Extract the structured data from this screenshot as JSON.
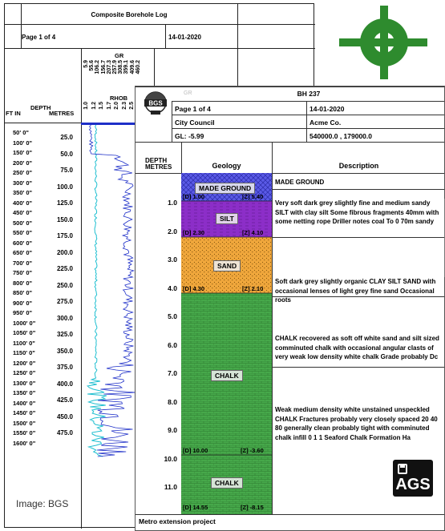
{
  "composite": {
    "title": "Composite Borehole Log",
    "page": "Page 1 of 4",
    "date": "14-01-2020",
    "gr_label": "GR",
    "rhob_label": "RHOB",
    "gr_scale": [
      "5.9",
      "55.6",
      "106.2",
      "156.7",
      "207.3",
      "257.9",
      "308.5",
      "359.1",
      "409.6",
      "460.2"
    ],
    "rhob_scale": [
      "1.0",
      "1.2",
      "1.5",
      "1.7",
      "2.0",
      "2.3",
      "2.5"
    ],
    "depth_header": "DEPTH",
    "ft_header": "FT IN",
    "metres_header": "METRES",
    "ft_ticks": [
      "50' 0\"",
      "100' 0\"",
      "150' 0\"",
      "200' 0\"",
      "250' 0\"",
      "300' 0\"",
      "350' 0\"",
      "400' 0\"",
      "450' 0\"",
      "500' 0\"",
      "550' 0\"",
      "600' 0\"",
      "650' 0\"",
      "700' 0\"",
      "750' 0\"",
      "800' 0\"",
      "850' 0\"",
      "900' 0\"",
      "950' 0\"",
      "1000' 0\"",
      "1050' 0\"",
      "1100' 0\"",
      "1150' 0\"",
      "1200' 0\"",
      "1250' 0\"",
      "1300' 0\"",
      "1350' 0\"",
      "1400' 0\"",
      "1450' 0\"",
      "1500' 0\"",
      "1550' 0\"",
      "1600' 0\""
    ],
    "metre_ticks": [
      "25.0",
      "50.0",
      "75.0",
      "100.0",
      "125.0",
      "150.0",
      "175.0",
      "200.0",
      "225.0",
      "250.0",
      "275.0",
      "300.0",
      "325.0",
      "350.0",
      "375.0",
      "400.0",
      "425.0",
      "450.0",
      "475.0"
    ]
  },
  "bgs_log": {
    "borehole": "BH 237",
    "page": "Page 1 of 4",
    "date": "14-01-2020",
    "client": "City Council",
    "contractor": "Acme Co.",
    "ground_level": "GL: -5.99",
    "coordinates": "540000.0 , 179000.0",
    "depth_header": "DEPTH",
    "metres_header": "METRES",
    "geology_header": "Geology",
    "description_header": "Description",
    "faint_gr_label": "GR",
    "depth_ticks": [
      "1.0",
      "2.0",
      "3.0",
      "4.0",
      "5.0",
      "6.0",
      "7.0",
      "8.0",
      "9.0",
      "10.0",
      "11.0"
    ],
    "strata": [
      {
        "name": "MADE GROUND",
        "color": "#5a5ae6"
      },
      {
        "name": "SILT",
        "color": "#8c2ec8"
      },
      {
        "name": "SAND",
        "color": "#f0a73c"
      },
      {
        "name": "CHALK",
        "color": "#46a84a"
      },
      {
        "name": "CHALK",
        "color": "#46a84a"
      }
    ],
    "samples": [
      {
        "d": "[D] 1.00",
        "z": "[Z] 5.40"
      },
      {
        "d": "[D] 2.30",
        "z": "[Z] 4.10"
      },
      {
        "d": "[D] 4.30",
        "z": "[Z] 2.10"
      },
      {
        "d": "[D] 10.00",
        "z": "[Z] -3.60"
      },
      {
        "d": "[D] 14.55",
        "z": "[Z] -8.15"
      }
    ],
    "descriptions": [
      "MADE GROUND",
      "Very soft dark grey slightly fine and medium sandy SILT with clay silt Some fibrous fragments 40mm with some netting rope Driller notes coal To 0 70m sandy",
      "Soft dark grey slightly organic CLAY SILT SAND with occasional lenses of light grey fine sand Occasional roots",
      "CHALK recovered as soft off white sand and silt sized comminuted chalk with occasional angular clasts of very weak low density white chalk Grade probably Dc",
      "Weak medium density white unstained unspeckled CHALK Fractures probably very closely spaced 20 40 80 generally clean probably tight with comminuted chalk infill 0 1 1 Seaford Chalk Formation Ha"
    ],
    "footer": "Metro extension project",
    "bgs_logo_text": "BGS",
    "ags_logo_text": "AGS"
  },
  "image_credit": "Image: BGS",
  "colors": {
    "brand_green": "#2e8b2e",
    "gr_trace": "#1e2fc8",
    "rhob_trace": "#1fbfd0"
  }
}
